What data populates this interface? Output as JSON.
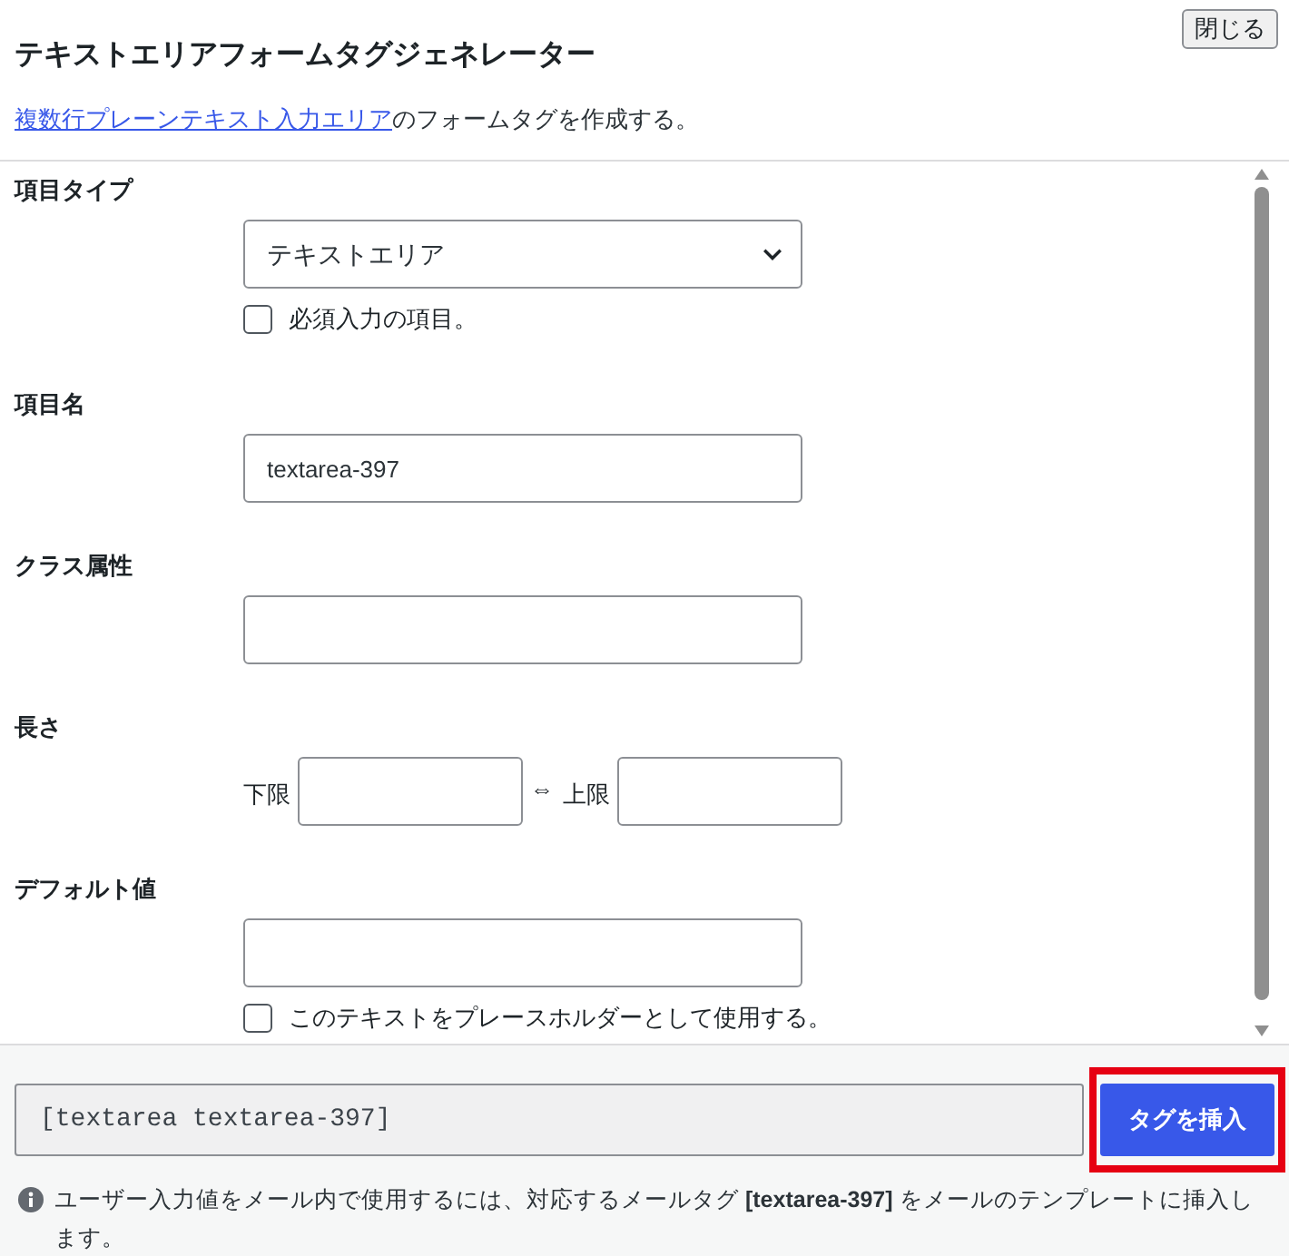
{
  "dialog": {
    "title": "テキストエリアフォームタグジェネレーター",
    "close_button": "閉じる"
  },
  "description": {
    "link": "複数行プレーンテキスト入力エリア",
    "text": "のフォームタグを作成する。"
  },
  "fields": [
    {
      "kind": "select",
      "label": "項目タイプ",
      "value": "テキストエリア",
      "checkbox": {
        "label": "必須入力の項目。",
        "checked": false
      }
    },
    {
      "kind": "text",
      "label": "項目名",
      "value": "textarea-397"
    },
    {
      "kind": "text",
      "label": "クラス属性"
    },
    {
      "kind": "range",
      "label": "長さ",
      "min_label": "下限",
      "separator": "⇔",
      "max_label": "上限"
    },
    {
      "kind": "text",
      "label": "デフォルト値",
      "checkbox": {
        "label": "このテキストをプレースホルダーとして使用する。",
        "checked": false
      }
    }
  ],
  "footer": {
    "tag_code": "[textarea textarea-397]",
    "insert_button": {
      "label": "タグを挿入",
      "highlighted": true
    },
    "note": "ユーザー入力値をメール内で使用するには、対応するメールタグ **[textarea-397]** をメールのテンプレートに挿入します。"
  }
}
